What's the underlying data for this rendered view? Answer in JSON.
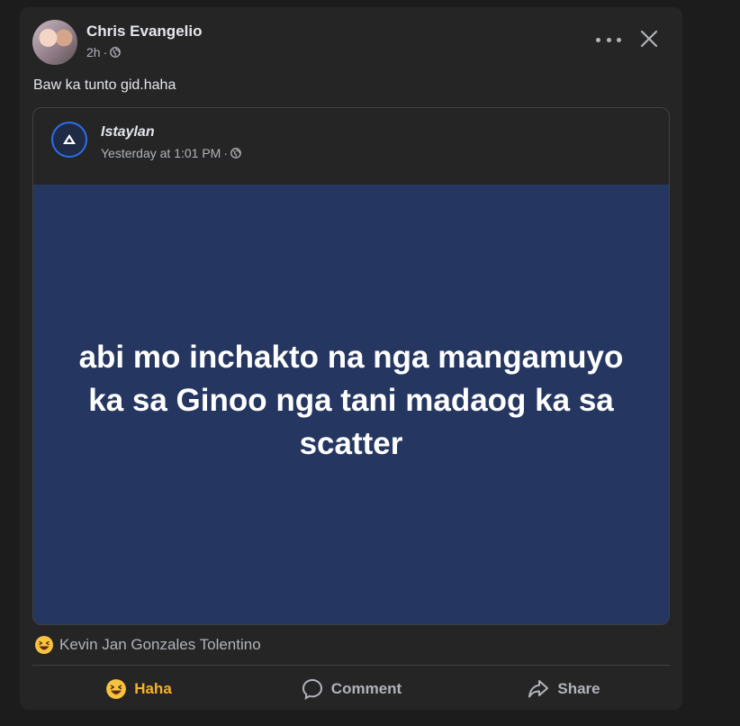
{
  "post": {
    "author": "Chris Evangelio",
    "time": "2h",
    "visibility_icon": "globe-icon",
    "text": "Baw ka tunto gid.haha"
  },
  "shared_post": {
    "page_name": "Istaylan",
    "time": "Yesterday at 1:01 PM",
    "visibility_icon": "globe-icon",
    "quote": "abi mo inchakto na nga mangamuyo ka sa Ginoo nga tani madaog ka sa scatter",
    "quote_bg": "#253761"
  },
  "reactions": {
    "reactor": "Kevin Jan Gonzales Tolentino",
    "icon": "haha-emoji-icon"
  },
  "actions": {
    "haha": "Haha",
    "comment": "Comment",
    "share": "Share"
  },
  "colors": {
    "background": "#1c1c1d",
    "card": "#252526",
    "haha_accent": "#f7b125",
    "muted_text": "#b0b3b8"
  }
}
